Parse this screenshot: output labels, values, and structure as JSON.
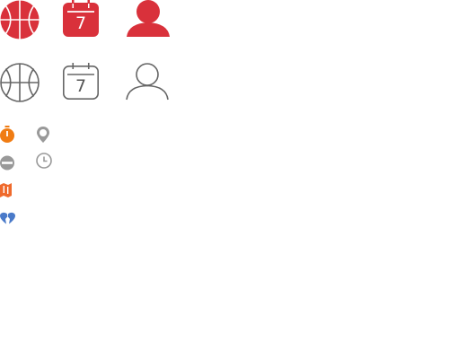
{
  "icons": {
    "large_filled": [
      {
        "icon": "basketball-icon",
        "color": "#d9313b"
      },
      {
        "icon": "calendar-icon",
        "color": "#d9313b",
        "day": "7"
      },
      {
        "icon": "user-icon",
        "color": "#d9313b"
      }
    ],
    "large_outline": [
      {
        "icon": "basketball-icon",
        "color": "#666666"
      },
      {
        "icon": "calendar-icon",
        "color": "#666666",
        "day": "7"
      },
      {
        "icon": "user-icon",
        "color": "#666666"
      }
    ],
    "small": [
      {
        "icon": "stopwatch-icon",
        "color": "#f07c13"
      },
      {
        "icon": "location-pin-icon",
        "color": "#999999"
      },
      {
        "icon": "no-entry-icon",
        "color": "#999999"
      },
      {
        "icon": "clock-icon",
        "color": "#999999"
      },
      {
        "icon": "map-icon",
        "color": "#ef6a2c"
      },
      {
        "icon": "heart-broken-icon",
        "color": "#4a7ac9"
      }
    ]
  }
}
